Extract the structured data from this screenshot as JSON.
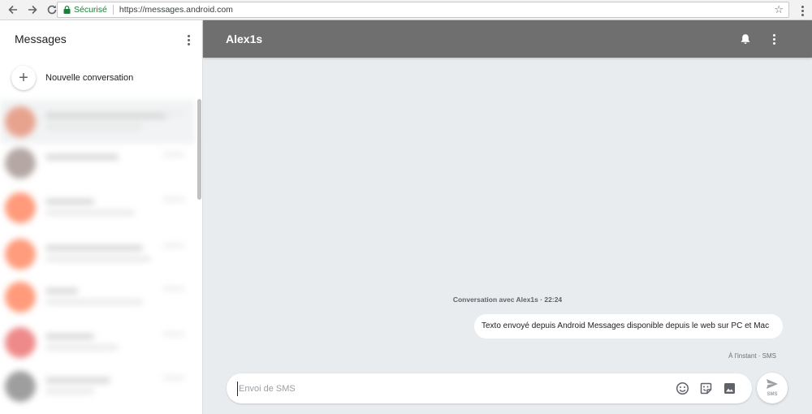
{
  "browser": {
    "secure_label": "Sécurisé",
    "url": "https://messages.android.com",
    "icons": [
      "back-icon",
      "forward-icon",
      "reload-icon",
      "lock-icon",
      "star-icon",
      "more-vert-icon"
    ]
  },
  "sidebar": {
    "title": "Messages",
    "new_conversation_label": "Nouvelle conversation",
    "conversations": [
      {
        "avatar_color": "#e8a38f",
        "blurred": true
      },
      {
        "avatar_color": "#b5a8a4",
        "blurred": true
      },
      {
        "avatar_color": "#ff9a7a",
        "blurred": true
      },
      {
        "avatar_color": "#ff9c7d",
        "blurred": true
      },
      {
        "avatar_color": "#ff9b7b",
        "blurred": true
      },
      {
        "avatar_color": "#ee8a8a",
        "blurred": true
      },
      {
        "avatar_color": "#9e9e9e",
        "blurred": true
      }
    ]
  },
  "conversation": {
    "contact_name": "Alex1s",
    "header": "Conversation avec Alex1s · 22:24",
    "messages": [
      {
        "text": "Texto envoyé depuis Android Messages disponible depuis le web sur PC et Mac",
        "meta": "À l'instant · SMS",
        "outgoing": true
      }
    ]
  },
  "composer": {
    "placeholder": "Envoi de SMS",
    "send_label": "SMS",
    "icons": [
      "emoji-icon",
      "sticker-icon",
      "image-icon",
      "send-icon"
    ]
  },
  "colors": {
    "topbar": "#6f6f6f",
    "background": "#e9ecef",
    "secure_green": "#188038"
  }
}
